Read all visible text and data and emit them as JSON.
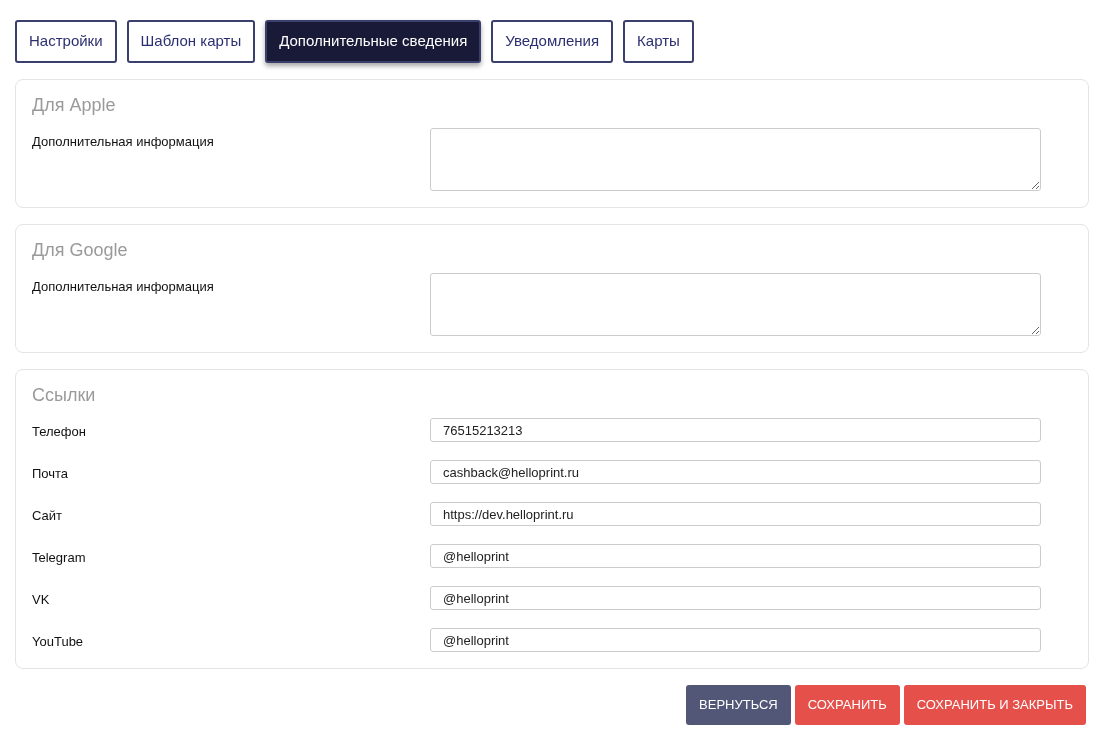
{
  "tabs": [
    {
      "label": "Настройки",
      "selected": false
    },
    {
      "label": "Шаблон карты",
      "selected": false
    },
    {
      "label": "Дополнительные сведения",
      "selected": true
    },
    {
      "label": "Уведомления",
      "selected": false
    },
    {
      "label": "Карты",
      "selected": false
    }
  ],
  "sections": [
    {
      "title": "Для Apple",
      "fields": [
        {
          "kind": "textarea",
          "label": "Дополнительная информация"
        }
      ]
    },
    {
      "title": "Для Google",
      "fields": [
        {
          "kind": "textarea",
          "label": "Дополнительная информация"
        }
      ]
    },
    {
      "title": "Ссылки",
      "fields": [
        {
          "kind": "input",
          "label": "Телефон",
          "value": "76515213213"
        },
        {
          "kind": "input",
          "label": "Почта",
          "value": "cashback@helloprint.ru"
        },
        {
          "kind": "input",
          "label": "Сайт",
          "value": "https://dev.helloprint.ru"
        },
        {
          "kind": "input",
          "label": "Telegram",
          "value": "@helloprint"
        },
        {
          "kind": "input",
          "label": "VK",
          "value": "@helloprint"
        },
        {
          "kind": "input",
          "label": "YouTube",
          "value": "@helloprint"
        }
      ]
    }
  ],
  "buttons": [
    {
      "kind": "secondary",
      "label": "ВЕРНУТЬСЯ"
    },
    {
      "kind": "primary",
      "label": "СОХРАНИТЬ"
    },
    {
      "kind": "primary",
      "label": "СОХРАНИТЬ И ЗАКРЫТЬ"
    }
  ]
}
